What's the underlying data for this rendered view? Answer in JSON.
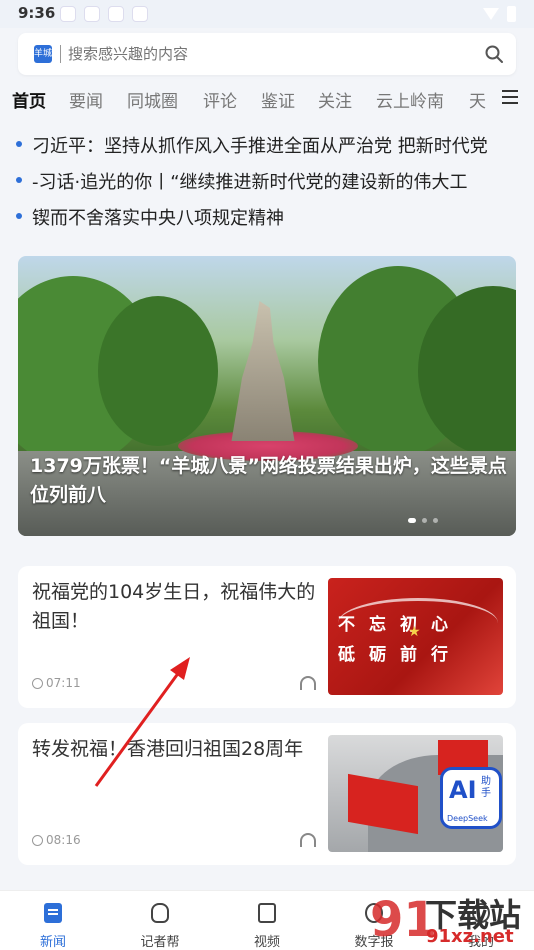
{
  "status_bar": {
    "time": "9:36"
  },
  "search": {
    "logo_text": "羊城",
    "placeholder": "搜索感兴趣的内容"
  },
  "tabs": [
    "首页",
    "要闻",
    "同城圈",
    "评论",
    "鉴证",
    "关注",
    "云上岭南",
    "天"
  ],
  "headlines": [
    "刁近平：坚持从抓作风入手推进全面从严治党 把新时代党",
    "-习话·追光的你丨“继续推进新时代党的建设新的伟大工",
    "锲而不舍落实中央八项规定精神"
  ],
  "banner": {
    "caption": "1379万张票！“羊城八景”网络投票结果出炉，这些景点位列前八"
  },
  "cards": [
    {
      "title": "祝福党的104岁生日，祝福伟大的祖国！",
      "time": "07:11",
      "thumb_words": [
        "不忘初心",
        "砥砺前行"
      ]
    },
    {
      "title": "转发祝福！香港回归祖国28周年",
      "time": "08:16",
      "badge": {
        "main": "AI",
        "sub": "助手",
        "brand": "DeepSeek"
      }
    }
  ],
  "bottom_nav": [
    "新闻",
    "记者帮",
    "视频",
    "数字报",
    "我的"
  ],
  "watermark": {
    "big": "下载站",
    "url": "91xz.net",
    "num": "91"
  },
  "colors": {
    "accent": "#2d6fd8",
    "arrow": "#e02020",
    "watermark": "#d62b2b"
  }
}
